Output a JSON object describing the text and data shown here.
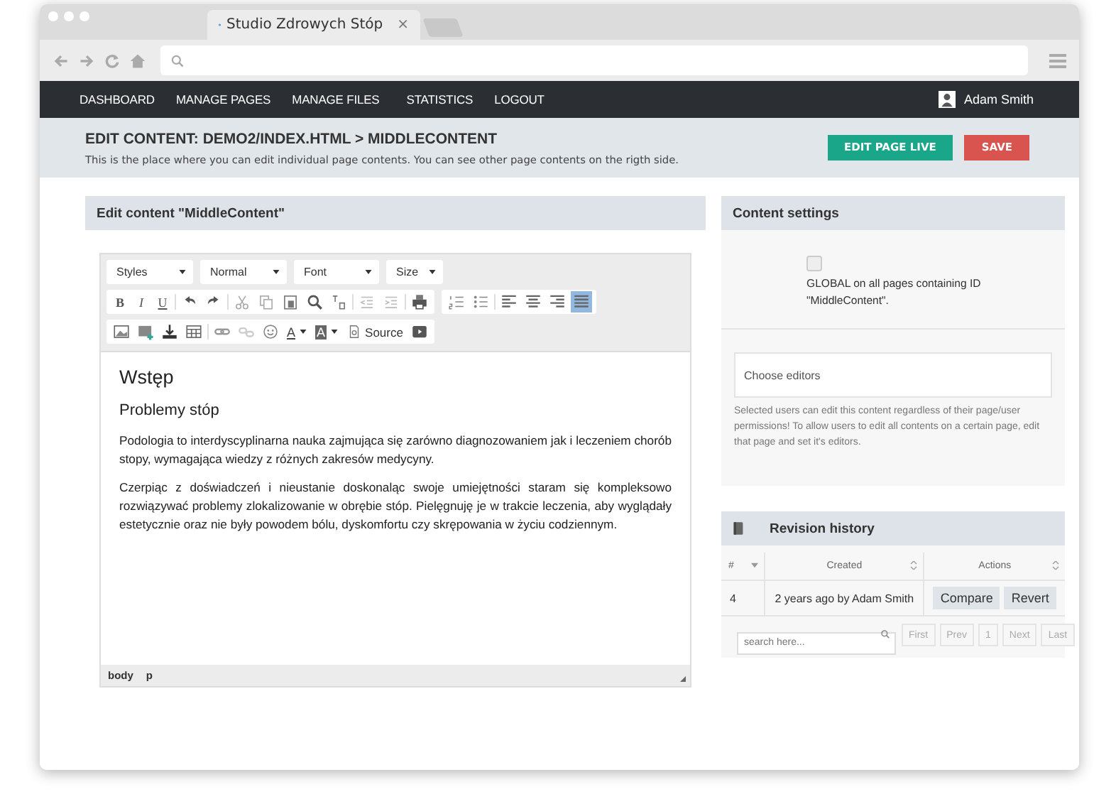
{
  "browser": {
    "tab_title": "Studio Zdrowych Stóp",
    "tab_close": "×"
  },
  "nav": {
    "items": [
      {
        "label": "DASHBOARD"
      },
      {
        "label": "MANAGE PAGES"
      },
      {
        "label": "MANAGE FILES"
      },
      {
        "label": "STATISTICS"
      },
      {
        "label": "LOGOUT"
      }
    ],
    "user": "Adam Smith"
  },
  "header": {
    "title": "EDIT CONTENT: DEMO2/INDEX.HTML > MIDDLECONTENT",
    "subtitle": "This is the place where you can edit individual page contents. You can see other page contents on the rigth side.",
    "buttons": [
      {
        "label": "EDIT PAGE LIVE",
        "kind": "primary"
      },
      {
        "label": "SAVE",
        "kind": "danger"
      }
    ]
  },
  "editor_panel": {
    "title": "Edit content \"MiddleContent\"",
    "dropdowns": [
      "Styles",
      "Normal",
      "Font",
      "Size"
    ],
    "format_buttons": [
      "B",
      "I",
      "U"
    ],
    "alignment_buttons": [
      {
        "selected": false
      },
      {
        "selected": false
      },
      {
        "selected": false
      },
      {
        "selected": true
      }
    ],
    "color_buttons": [
      "A",
      "A"
    ],
    "source_label": "Source",
    "content": [
      {
        "kind": "h1",
        "text": "Wstęp"
      },
      {
        "kind": "h2",
        "text": "Problemy stóp"
      },
      {
        "kind": "p",
        "text": "Podologia to interdyscyplinarna nauka zajmująca się zarówno diagnozowaniem jak i leczeniem chorób stopy, wymagająca wiedzy z różnych zakresów medycyny."
      },
      {
        "kind": "p",
        "text": "Czerpiąc z doświadczeń i nieustanie doskonaląc swoje umiejętności staram się kompleksowo rozwiązywać problemy zlokalizowanie w obrębie stóp. Pielęgnuję je w trakcie leczenia, aby wyglądały estetycznie oraz nie były powodem bólu, dyskomfortu czy skrępowania w życiu codziennym."
      }
    ],
    "path": [
      "body",
      "p"
    ]
  },
  "settings_panel": {
    "title": "Content settings",
    "global": {
      "checked": false,
      "label": "GLOBAL on all pages containing ID \"MiddleContent\"."
    },
    "editors_placeholder": "Choose editors",
    "help": "Selected users can edit this content regardless of their page/user permissions! To allow users to edit all contents on a certain page, edit that page and set it's editors."
  },
  "revision_panel": {
    "title": "Revision history",
    "columns": [
      "#",
      "Created",
      "Actions"
    ],
    "rows": [
      {
        "number": "4",
        "created": "2 years ago by Adam Smith",
        "actions": [
          "Compare",
          "Revert"
        ]
      }
    ],
    "search_placeholder": "search here...",
    "pager": [
      {
        "label": "First",
        "disabled": true
      },
      {
        "label": "Prev",
        "disabled": true
      },
      {
        "label": "1",
        "disabled": true
      },
      {
        "label": "Next",
        "disabled": true
      },
      {
        "label": "Last",
        "disabled": true
      }
    ]
  }
}
